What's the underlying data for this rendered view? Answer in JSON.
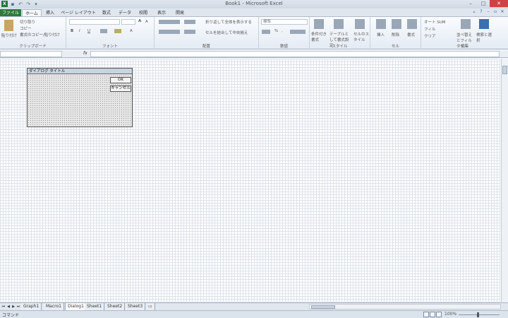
{
  "window": {
    "title": "Book1 - Microsoft Excel",
    "app_icon": "X",
    "quick_access": [
      "save-icon",
      "undo-icon",
      "redo-icon",
      "dropdown-icon"
    ]
  },
  "ribbon_tabs": [
    "ファイル",
    "ホーム",
    "挿入",
    "ページ レイアウト",
    "数式",
    "データ",
    "校閲",
    "表示",
    "開発"
  ],
  "ribbon": {
    "clipboard": {
      "paste": "貼り付け",
      "cut": "切り取り",
      "copy": "コピー",
      "format_painter": "書式のコピー/貼り付け",
      "label": "クリップボード"
    },
    "font": {
      "bold": "B",
      "italic": "I",
      "underline": "U",
      "grow": "A",
      "shrink": "A",
      "color": "A",
      "label": "フォント"
    },
    "alignment": {
      "wrap": "折り返して全体を表示する",
      "merge": "セルを結合して中央揃え",
      "label": "配置"
    },
    "number": {
      "format": "標準",
      "percent": "%",
      "comma": ",",
      "label": "数値"
    },
    "styles": {
      "conditional": "条件付き書式",
      "table": "テーブルとして書式設定",
      "cell": "セルのスタイル",
      "label": "スタイル"
    },
    "cells": {
      "insert": "挿入",
      "delete": "削除",
      "format": "書式",
      "label": "セル"
    },
    "editing": {
      "autosum": "オート SUM",
      "fill": "フィル",
      "clear": "クリア",
      "sort": "並べ替えとフィルター",
      "find": "検索と選択",
      "label": "編集"
    }
  },
  "formula_bar": {
    "fx": "fx"
  },
  "dialog": {
    "title": "ダイアログ タイトル",
    "ok": "OK",
    "cancel": "キャンセル"
  },
  "sheet_tabs": [
    "Graph1",
    "Macro1",
    "Dialog1",
    "Sheet1",
    "Sheet2",
    "Sheet3"
  ],
  "active_sheet": "Dialog1",
  "status": {
    "mode": "コマンド",
    "zoom": "100%"
  }
}
